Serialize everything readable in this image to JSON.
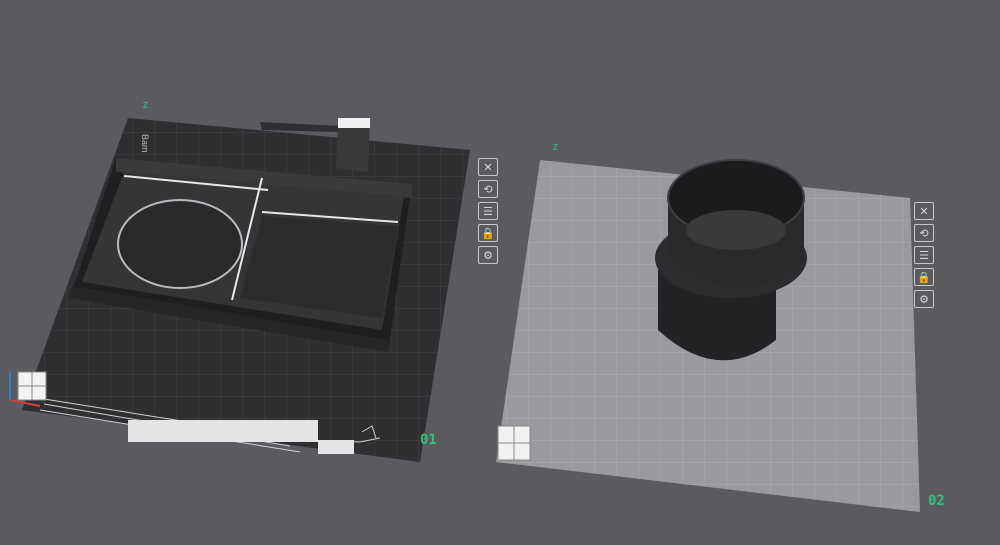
{
  "plates": [
    {
      "number": "01",
      "label": "Bam",
      "axis_mark": "z"
    },
    {
      "number": "02",
      "axis_mark": "z"
    }
  ],
  "plate_controls": [
    {
      "name": "close",
      "icon": "close-icon",
      "glyph": "✕"
    },
    {
      "name": "auto-orient",
      "icon": "orient-icon",
      "glyph": "⟲"
    },
    {
      "name": "arrange",
      "icon": "arrange-icon",
      "glyph": "☰"
    },
    {
      "name": "lock",
      "icon": "lock-icon",
      "glyph": "🔒"
    },
    {
      "name": "settings",
      "icon": "gear-icon",
      "glyph": "⚙"
    }
  ],
  "colors": {
    "background": "#5b5b5f",
    "plate_dark": "#2f2f32",
    "plate_light": "#9a9a9e",
    "accent_green": "#2ec27e",
    "model": "#2a2a2c"
  }
}
